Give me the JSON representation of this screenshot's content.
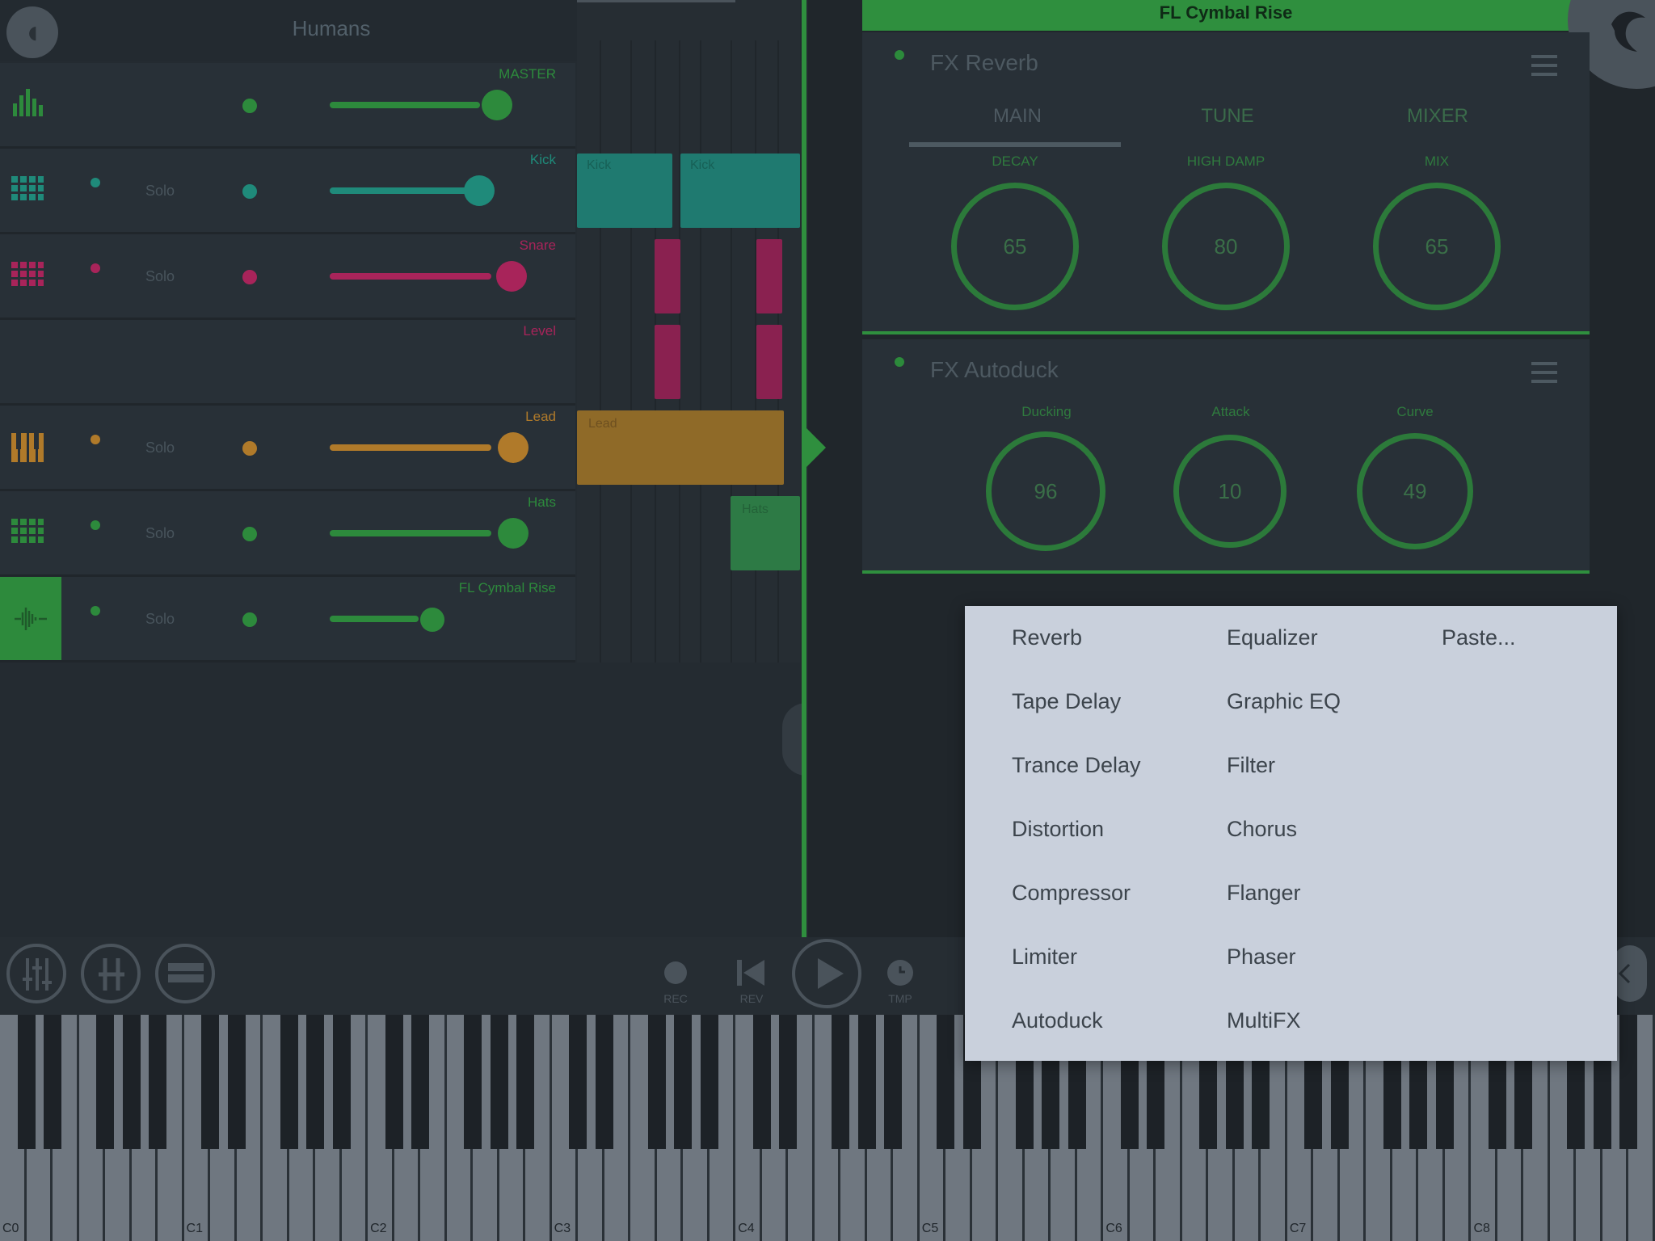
{
  "project": {
    "title": "Humans"
  },
  "tracks": [
    {
      "name": "MASTER",
      "color": "#2d8a3c",
      "solo": ""
    },
    {
      "name": "Kick",
      "color": "#1f8a7a",
      "solo": "Solo"
    },
    {
      "name": "Snare",
      "color": "#a8245a",
      "solo": "Solo"
    },
    {
      "name": "Level",
      "color": "#a8245a",
      "solo": ""
    },
    {
      "name": "Lead",
      "color": "#b07a2a",
      "solo": "Solo"
    },
    {
      "name": "Hats",
      "color": "#2d8a3c",
      "solo": "Solo"
    },
    {
      "name": "FL Cymbal Rise",
      "color": "#2d8a3c",
      "solo": "Solo"
    }
  ],
  "clips": {
    "kick1": "Kick",
    "kick2": "Kick",
    "lead": "Lead",
    "hats": "Hats"
  },
  "fx_header": "FL Cymbal Rise",
  "fx_reverb": {
    "title": "FX Reverb",
    "tabs": [
      "MAIN",
      "TUNE",
      "MIXER"
    ],
    "knobs": [
      {
        "label": "DECAY",
        "value": "65"
      },
      {
        "label": "HIGH DAMP",
        "value": "80"
      },
      {
        "label": "MIX",
        "value": "65"
      }
    ]
  },
  "fx_autoduck": {
    "title": "FX Autoduck",
    "knobs": [
      {
        "label": "Ducking",
        "value": "96"
      },
      {
        "label": "Attack",
        "value": "10"
      },
      {
        "label": "Curve",
        "value": "49"
      }
    ]
  },
  "transport": {
    "rec": "REC",
    "rev": "REV",
    "tmp": "TMP"
  },
  "piano_octaves": [
    "C0",
    "C1",
    "C2",
    "C3",
    "C4",
    "C5",
    "C6",
    "C7",
    "C8"
  ],
  "popup_menu": {
    "col1": [
      "Reverb",
      "Tape Delay",
      "Trance Delay",
      "Distortion",
      "Compressor",
      "Limiter",
      "Autoduck"
    ],
    "col2": [
      "Equalizer",
      "Graphic EQ",
      "Filter",
      "Chorus",
      "Flanger",
      "Phaser",
      "MultiFX"
    ],
    "col3": [
      "Paste..."
    ]
  },
  "colors": {
    "accent": "#2f8f3e",
    "background": "#20262b",
    "popup": "#c9d0dc"
  }
}
